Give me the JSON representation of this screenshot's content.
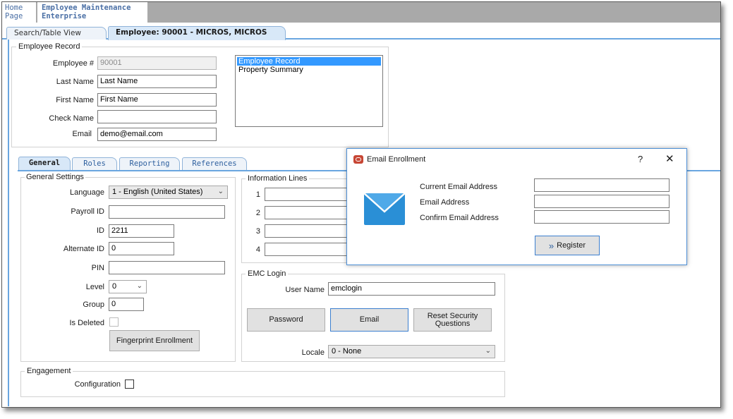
{
  "topbar": {
    "home": "Home Page",
    "employee_maintenance": "Employee Maintenance Enterprise"
  },
  "doc_tabs": {
    "search": "Search/Table View",
    "employee": "Employee: 90001 - MICROS, MICROS"
  },
  "employee_record": {
    "title": "Employee Record",
    "employee_num_label": "Employee #",
    "employee_num_value": "90001",
    "last_name_label": "Last Name",
    "last_name_value": "Last Name",
    "first_name_label": "First Name",
    "first_name_value": "First Name",
    "check_name_label": "Check Name",
    "check_name_value": "",
    "email_label": "Email",
    "email_value": "demo@email.com",
    "list_items": [
      "Employee Record",
      "Property Summary"
    ]
  },
  "inner_tabs": [
    "General",
    "Roles",
    "Reporting",
    "References"
  ],
  "general_settings": {
    "title": "General Settings",
    "language_label": "Language",
    "language_value": "1 - English (United States)",
    "payroll_label": "Payroll ID",
    "payroll_value": "",
    "id_label": "ID",
    "id_value": "2211",
    "alt_id_label": "Alternate ID",
    "alt_id_value": "0",
    "pin_label": "PIN",
    "pin_value": "",
    "level_label": "Level",
    "level_value": "0",
    "group_label": "Group",
    "group_value": "0",
    "is_deleted_label": "Is Deleted",
    "fingerprint_button": "Fingerprint Enrollment"
  },
  "information_lines": {
    "title": "Information Lines",
    "numbers": [
      "1",
      "2",
      "3",
      "4"
    ]
  },
  "emc_login": {
    "title": "EMC Login",
    "user_name_label": "User Name",
    "user_name_value": "emclogin",
    "password_button": "Password",
    "email_button": "Email",
    "reset_button": "Reset Security Questions",
    "locale_label": "Locale",
    "locale_value": "0 - None"
  },
  "engagement": {
    "title": "Engagement",
    "configuration_label": "Configuration"
  },
  "dialog": {
    "title": "Email Enrollment",
    "help": "?",
    "close": "✕",
    "current_email_label": "Current Email Address",
    "email_label": "Email Address",
    "confirm_email_label": "Confirm Email Address",
    "register_button": "Register",
    "register_icon": "»"
  },
  "colors": {
    "accent_blue": "#6aa6e0",
    "selection_blue": "#3399ff",
    "oracle_red": "#c74634",
    "envelope_blue": "#2a8fd6"
  }
}
